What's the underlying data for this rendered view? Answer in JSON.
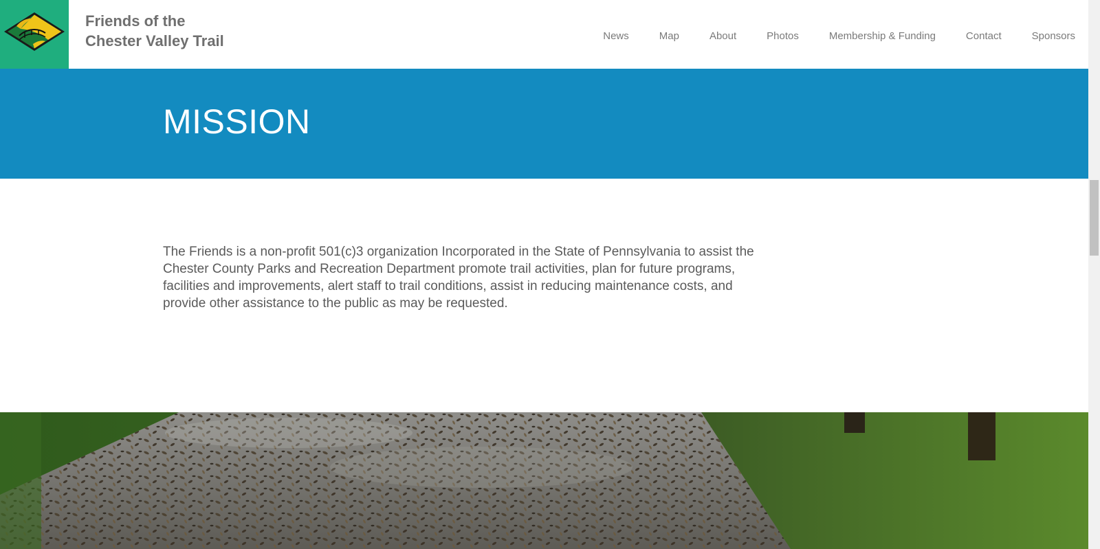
{
  "header": {
    "site_title_line1": "Friends of the",
    "site_title_line2": "Chester Valley Trail",
    "logo_icon": "trail-bridge-logo-icon",
    "nav": [
      {
        "label": "News"
      },
      {
        "label": "Map"
      },
      {
        "label": "About"
      },
      {
        "label": "Photos"
      },
      {
        "label": "Membership & Funding"
      },
      {
        "label": "Contact"
      },
      {
        "label": "Sponsors"
      }
    ]
  },
  "band": {
    "title": "MISSION",
    "color": "#138bc0"
  },
  "main": {
    "mission_text": "The Friends is a non-profit 501(c)3 organization Incorporated in the State of Pennsylvania to assist the Chester County Parks and Recreation Department promote trail activities, plan for future programs, facilities and improvements, alert staff to trail conditions, assist in reducing maintenance costs, and provide other assistance to the public as may be requested."
  },
  "photo": {
    "icon": "trail-leaves-photo"
  },
  "colors": {
    "brand_green": "#1fae7e",
    "brand_blue": "#138bc0",
    "text_gray": "#5a5a5a"
  }
}
